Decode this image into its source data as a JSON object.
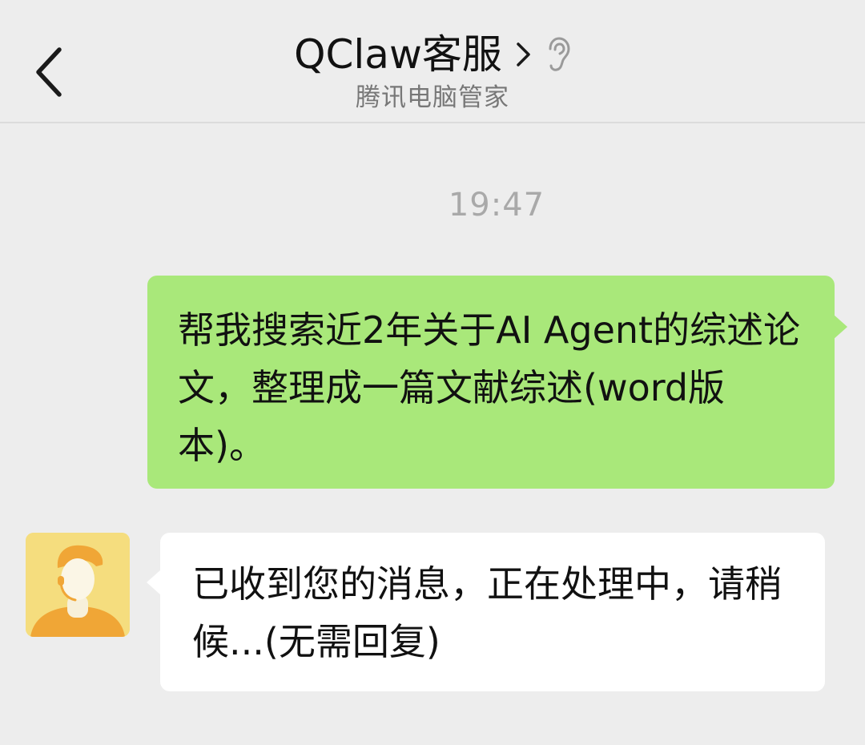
{
  "header": {
    "title": "QClaw客服",
    "subtitle": "腾讯电脑管家",
    "back_icon": "chevron-left-icon",
    "more_icon": "chevron-right-icon",
    "status_icon": "ear-icon"
  },
  "chat": {
    "timestamp": "19:47",
    "messages": [
      {
        "direction": "outgoing",
        "text": "帮我搜索近2年关于AI Agent的综述论文，整理成一篇文献综述(word版本)。",
        "bubble_color": "#a9e87a"
      },
      {
        "direction": "incoming",
        "sender_avatar": "customer-service-avatar",
        "text": "已收到您的消息，正在处理中，请稍候...(无需回复)",
        "bubble_color": "#ffffff"
      }
    ]
  },
  "colors": {
    "background": "#ededed",
    "outgoing_bubble": "#a9e87a",
    "incoming_bubble": "#ffffff",
    "avatar_background": "#f5dd7e",
    "avatar_figure": "#f0a636"
  }
}
